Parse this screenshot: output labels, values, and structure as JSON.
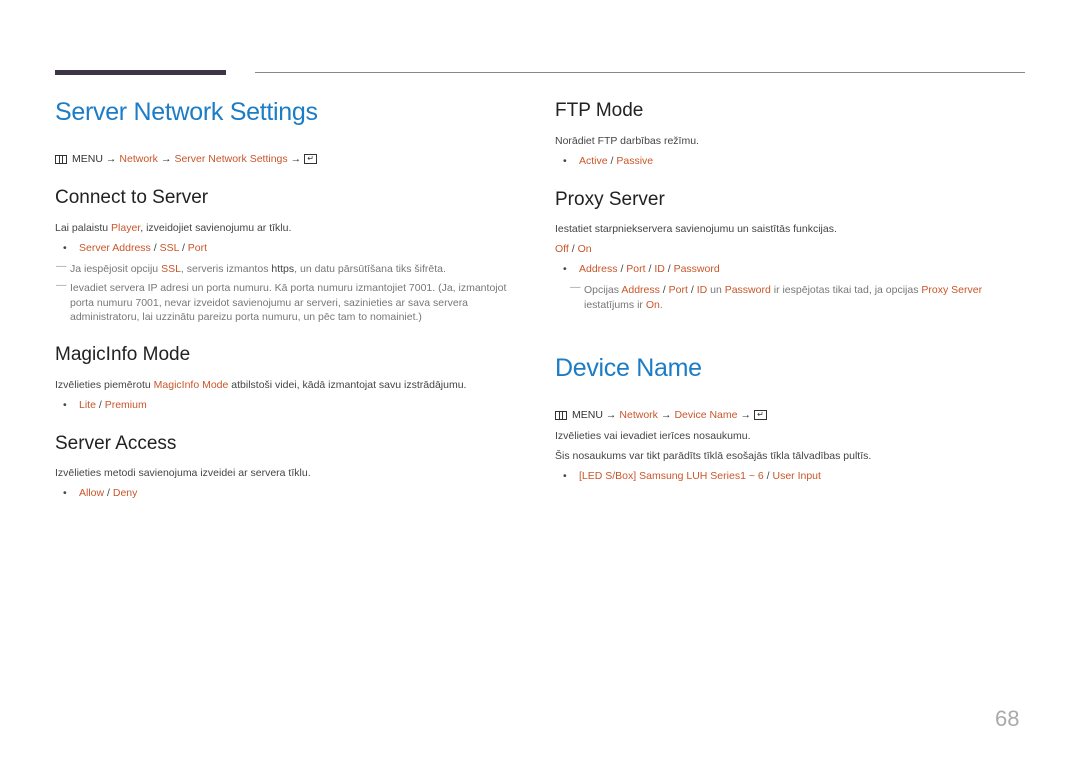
{
  "page_number": "68",
  "left": {
    "title": "Server Network Settings",
    "menu_path": {
      "menu": "MENU",
      "arrow": "→",
      "items": [
        "Network",
        "Server Network Settings"
      ]
    },
    "connect_to_server": {
      "heading": "Connect to Server",
      "desc_pre": "Lai palaistu ",
      "desc_hl": "Player",
      "desc_post": ", izveidojiet savienojumu ar tīklu.",
      "options": [
        "Server Address",
        "SSL",
        "Port"
      ],
      "note1_pre": "Ja iespējosit opciju ",
      "note1_hl": "SSL",
      "note1_mid": ", serveris izmantos ",
      "note1_bold": "https",
      "note1_post": ", un datu pārsūtīšana tiks šifrēta.",
      "note2": "Ievadiet servera IP adresi un porta numuru. Kā porta numuru izmantojiet 7001. (Ja, izmantojot porta numuru 7001, nevar izveidot savienojumu ar serveri, sazinieties ar sava servera administratoru, lai uzzinātu pareizu porta numuru, un pēc tam to nomainiet.)"
    },
    "magicinfo_mode": {
      "heading": "MagicInfo Mode",
      "desc_pre": "Izvēlieties piemērotu ",
      "desc_hl": "MagicInfo Mode",
      "desc_post": " atbilstoši videi, kādā izmantojat savu izstrādājumu.",
      "options": [
        "Lite",
        "Premium"
      ]
    },
    "server_access": {
      "heading": "Server Access",
      "desc": "Izvēlieties metodi savienojuma izveidei ar servera tīklu.",
      "options": [
        "Allow",
        "Deny"
      ]
    }
  },
  "right": {
    "ftp_mode": {
      "heading": "FTP Mode",
      "desc": "Norādiet FTP darbības režīmu.",
      "options": [
        "Active",
        "Passive"
      ]
    },
    "proxy_server": {
      "heading": "Proxy Server",
      "desc": "Iestatiet starpniekservera savienojumu un saistītās funkcijas.",
      "states": [
        "Off",
        "On"
      ],
      "options": [
        "Address",
        "Port",
        "ID",
        "Password"
      ],
      "note_pre": "Opcijas ",
      "note_opts": [
        "Address",
        "Port",
        "ID"
      ],
      "note_un": " un ",
      "note_pw": "Password",
      "note_mid": " ir iespējotas tikai tad, ja opcijas ",
      "note_ps": "Proxy Server",
      "note_line2_pre": "iestatījums ir ",
      "note_on": "On",
      "note_end": "."
    },
    "device_name": {
      "title": "Device Name",
      "menu_path": {
        "menu": "MENU",
        "arrow": "→",
        "items": [
          "Network",
          "Device Name"
        ]
      },
      "desc1": "Izvēlieties vai ievadiet ierīces nosaukumu.",
      "desc2": "Šis nosaukums var tikt parādīts tīklā esošajās tīkla tālvadības pultīs.",
      "option_a": "[LED S/Box] Samsung LUH Series1 ~ 6",
      "option_b": "User Input"
    }
  },
  "glyphs": {
    "bullet": "•",
    "slash": " / ",
    "note_dash": "―",
    "enter": "↵"
  }
}
